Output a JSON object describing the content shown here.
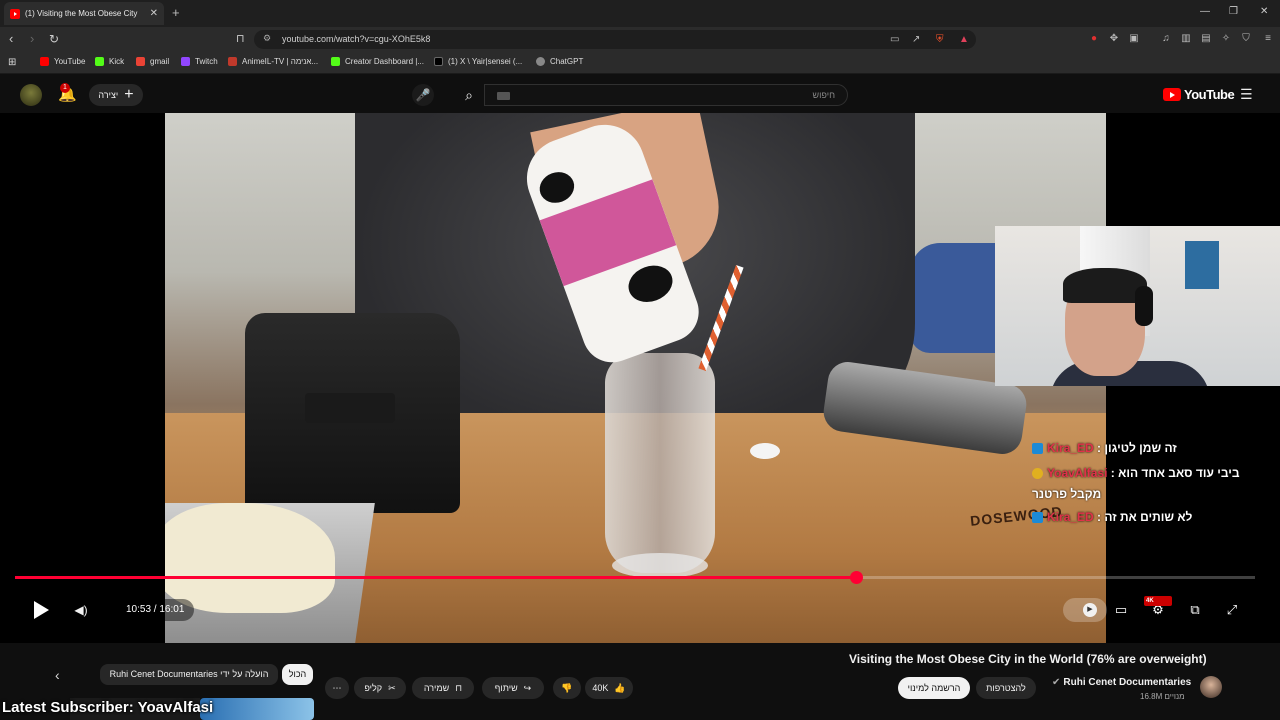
{
  "browser": {
    "tab_title": "(1) Visiting the Most Obese City",
    "tab_close": "✕",
    "new_tab": "+",
    "url": "youtube.com/watch?v=cgu-XOhE5k8",
    "bookmarks": [
      {
        "label": "YouTube",
        "color": "#ff0000"
      },
      {
        "label": "Kick",
        "color": "#53fc18"
      },
      {
        "label": "gmail",
        "color": "#ea4335"
      },
      {
        "label": "Twitch",
        "color": "#9146ff"
      },
      {
        "label": "AnimeIL-TV | אנימה...",
        "color": "#c0392b"
      },
      {
        "label": "Creator Dashboard |...",
        "color": "#53fc18"
      },
      {
        "label": "(1) X \\ Yair|sensei (...",
        "color": "#000000"
      },
      {
        "label": "ChatGPT",
        "color": "#888888"
      }
    ]
  },
  "youtube": {
    "create_label": "יצירה",
    "notification_count": "1",
    "search_placeholder": "חיפוש",
    "logo_text": "YouTube"
  },
  "player": {
    "current_time": "10:53",
    "duration": "16:01",
    "time_display": "10:53 / 16:01",
    "progress": 0.678,
    "hd_badge": "4K",
    "board_text": "DOSEWOOD"
  },
  "chat": [
    {
      "name": "Kira_ED",
      "sep": " : ",
      "message": "זה שמן לטיגון",
      "badge": "blue"
    },
    {
      "name": "YoavAlfasi",
      "sep": " : ",
      "message": "ביבי עוד סאב אחד הוא",
      "badge": "gold"
    },
    {
      "name": "",
      "sep": "",
      "message": "מקבל פרטנר",
      "badge": ""
    },
    {
      "name": "Kira_ED",
      "sep": " : ",
      "message": "לא שותים את זה",
      "badge": "blue"
    }
  ],
  "video": {
    "title": "Visiting the Most Obese City in the World (76% are overweight)",
    "channel": "Ruhi Cenet Documentaries",
    "subscribers": "16.8M מנויים",
    "join_label": "להצטרפות",
    "subscribe_label": "הרשמה למינוי",
    "likes": "40K",
    "share_label": "שיתוף",
    "save_label": "שמירה",
    "clip_label": "קליפ",
    "more_label": "⋯"
  },
  "chips": {
    "all": "הכול",
    "channel": "Ruhi Cenet Documentaries הועלה על ידי"
  },
  "overlay": {
    "latest_subscriber": "Latest Subscriber: YoavAlfasi"
  }
}
